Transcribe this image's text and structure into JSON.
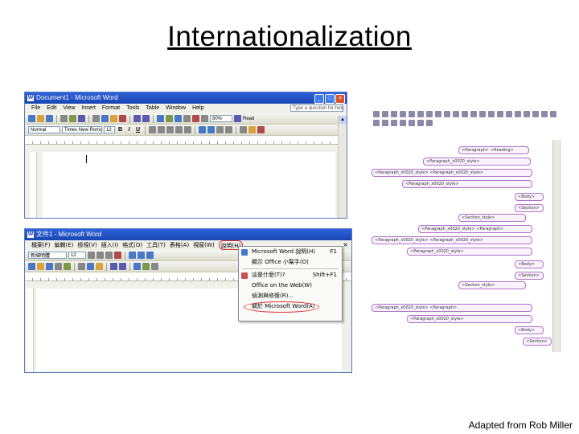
{
  "slide": {
    "title": "Internationalization",
    "credit": "Adapted from Rob Miller"
  },
  "word_en": {
    "title": "Document1 - Microsoft Word",
    "menus": [
      "File",
      "Edit",
      "View",
      "Insert",
      "Format",
      "Tools",
      "Table",
      "Window",
      "Help"
    ],
    "help_placeholder": "Type a question for help",
    "style_combo": "Normal",
    "font_combo": "Times New Roman",
    "size_combo": "12",
    "zoom_combo": "80%",
    "read_label": "Read",
    "bold_label": "B",
    "italic_label": "I",
    "underline_label": "U"
  },
  "word_zh": {
    "title": "文件1 - Microsoft Word",
    "menus": [
      "檔案(F)",
      "編輯(E)",
      "檢視(V)",
      "插入(I)",
      "格式(O)",
      "工具(T)",
      "表格(A)",
      "視窗(W)",
      "說明(H)"
    ],
    "font_combo": "新細明體",
    "size_combo": "12",
    "help_menu": {
      "items": [
        {
          "label": "Microsoft Word 說明(H)",
          "shortcut": "F1"
        },
        {
          "label": "顯示 Office 小幫手(O)",
          "shortcut": ""
        },
        {
          "label": "這是什麼(T)?",
          "shortcut": "Shift+F1"
        },
        {
          "label": "Office on the Web(W)",
          "shortcut": ""
        },
        {
          "label": "偵測與修復(R)...",
          "shortcut": ""
        },
        {
          "label": "關於 Microsoft Word(A)",
          "shortcut": ""
        }
      ]
    }
  },
  "word_ar": {
    "tags": [
      "<Paragraph> <Heading>",
      "<Paragraph_x0020_style>",
      "<Paragraph_x0020_style> <Paragraph_x0020_style>",
      "<Paragraph_x0020_style>",
      "<Body>",
      "<Section>",
      "<Section_style>",
      "<Paragraph_x0020_style> <Paragraph>",
      "<Paragraph_x0020_style> <Paragraph_x0020_style>",
      "<Paragraph_x0020_style>",
      "<Body>",
      "<Section>",
      "<Section_style>",
      "<Paragraph_x0020_style> <Paragraph>",
      "<Paragraph_x0020_style>",
      "<Body>",
      "<Section>"
    ]
  },
  "colors": {
    "titlebar": "#1a46b4",
    "menu_highlight_circle": "#e03030",
    "xml_tag_border": "#b070c8"
  }
}
